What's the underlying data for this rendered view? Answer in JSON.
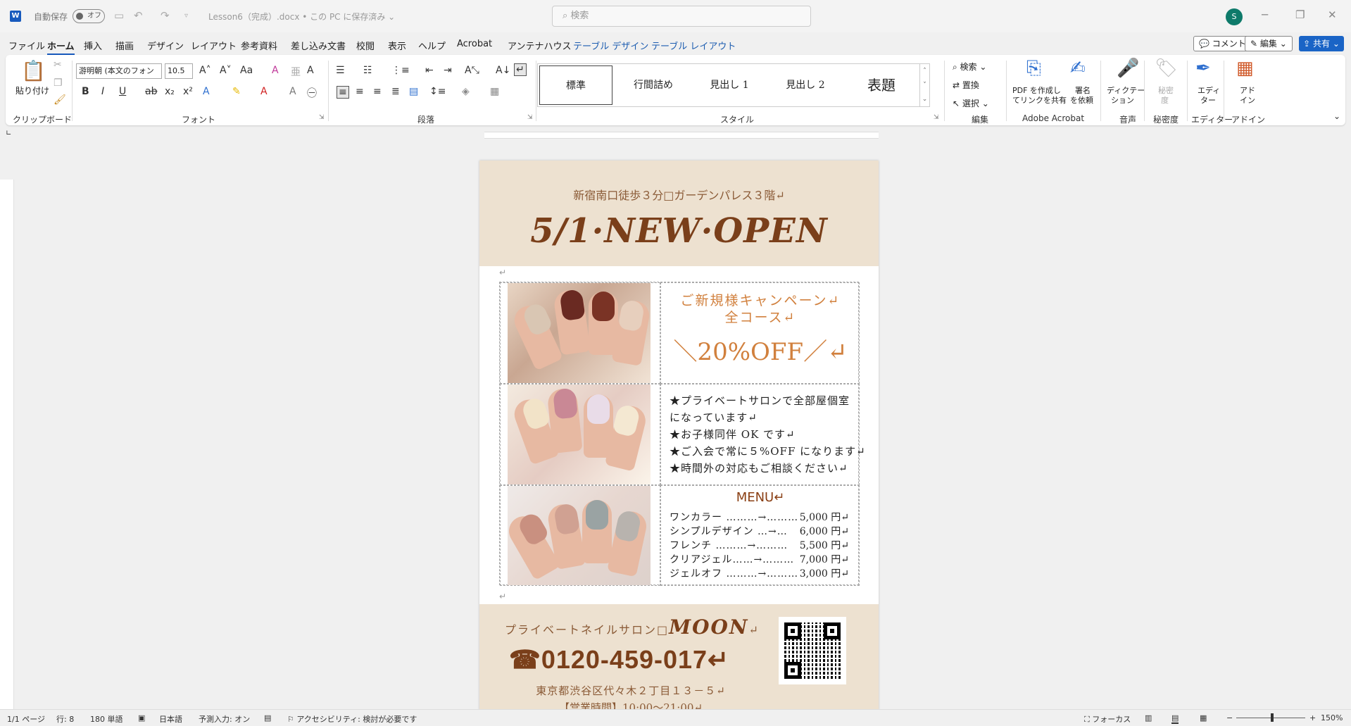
{
  "titlebar": {
    "autosave_label": "自動保存",
    "autosave_state": "オフ",
    "doc_title": "Lesson6（完成）.docx • この PC に保存済み ⌄",
    "search_placeholder": "検索",
    "avatar_initial": "S"
  },
  "menu": {
    "items": [
      "ファイル",
      "ホーム",
      "挿入",
      "描画",
      "デザイン",
      "レイアウト",
      "参考資料",
      "差し込み文書",
      "校閲",
      "表示",
      "ヘルプ",
      "Acrobat",
      "アンテナハウス",
      "テーブル デザイン",
      "テーブル レイアウト"
    ],
    "comment_label": "コメント",
    "edit_label": "編集",
    "share_label": "共有"
  },
  "ribbon": {
    "clipboard": {
      "paste_label": "貼り付け",
      "group_label": "クリップボード"
    },
    "font": {
      "font_name": "游明朝 (本文のフォン",
      "font_size": "10.5",
      "group_label": "フォント"
    },
    "paragraph": {
      "group_label": "段落"
    },
    "styles": {
      "items": [
        "標準",
        "行間詰め",
        "見出し 1",
        "見出し 2",
        "表題"
      ],
      "group_label": "スタイル"
    },
    "editing": {
      "find_label": "検索",
      "replace_label": "置換",
      "select_label": "選択",
      "group_label": "編集"
    },
    "acrobat": {
      "pdf_label_1": "PDF を作成し",
      "pdf_label_2": "てリンクを共有",
      "sign_label_1": "署名",
      "sign_label_2": "を依頼",
      "group_label": "Adobe Acrobat"
    },
    "voice": {
      "dictate_label_1": "ディクテー",
      "dictate_label_2": "ション",
      "group_label": "音声"
    },
    "sensitivity": {
      "label_1": "秘密",
      "label_2": "度",
      "group_label": "秘密度"
    },
    "editor": {
      "label_1": "エディ",
      "label_2": "ター",
      "group_label": "エディター"
    },
    "addin": {
      "label_1": "アド",
      "label_2": "イン",
      "group_label": "アドイン"
    }
  },
  "document": {
    "address_top": "新宿南口徒歩３分□ガーデンパレス３階↵",
    "headline": "5/1·NEW·OPEN",
    "campaign_line1": "ご新規様キャンペーン↵",
    "campaign_line2": "全コース↵",
    "discount": "＼20%OFF／↵",
    "features": [
      "★プライベートサロンで全部屋個室",
      "になっています↵",
      "★お子様同伴 OK です↵",
      "★ご入会で常に５%OFF になります↵",
      "★時間外の対応もご相談ください↵"
    ],
    "menu_title": "MENU↵",
    "menu_items": [
      {
        "name": "ワンカラー ………→………",
        "price": "5,000 円↵"
      },
      {
        "name": "シンプルデザイン …→…",
        "price": "6,000 円↵"
      },
      {
        "name": "フレンチ ………→………",
        "price": "5,500 円↵"
      },
      {
        "name": "クリアジェル……→………",
        "price": "7,000 円↵"
      },
      {
        "name": "ジェルオフ ………→………",
        "price": "3,000 円↵"
      }
    ],
    "salon_prefix": "プライベートネイルサロン□",
    "salon_brand": "MOON",
    "salon_suffix": "↵",
    "phone": "☎0120-459-017↵",
    "address_bottom": "東京都渋谷区代々木２丁目１３－５↵",
    "hours": "【営業時間】10:00～21:00↵"
  },
  "status": {
    "page": "1/1 ページ",
    "line": "行: 8",
    "words": "180 単語",
    "language": "日本語",
    "predictive": "予測入力: オン",
    "accessibility": "アクセシビリティ: 検討が必要です",
    "focus": "フォーカス",
    "zoom": "150%"
  },
  "colors": {
    "band": "#ede1d0",
    "brown_dark": "#7a3f1a",
    "orange": "#d1803d",
    "accent_blue": "#185abd"
  }
}
